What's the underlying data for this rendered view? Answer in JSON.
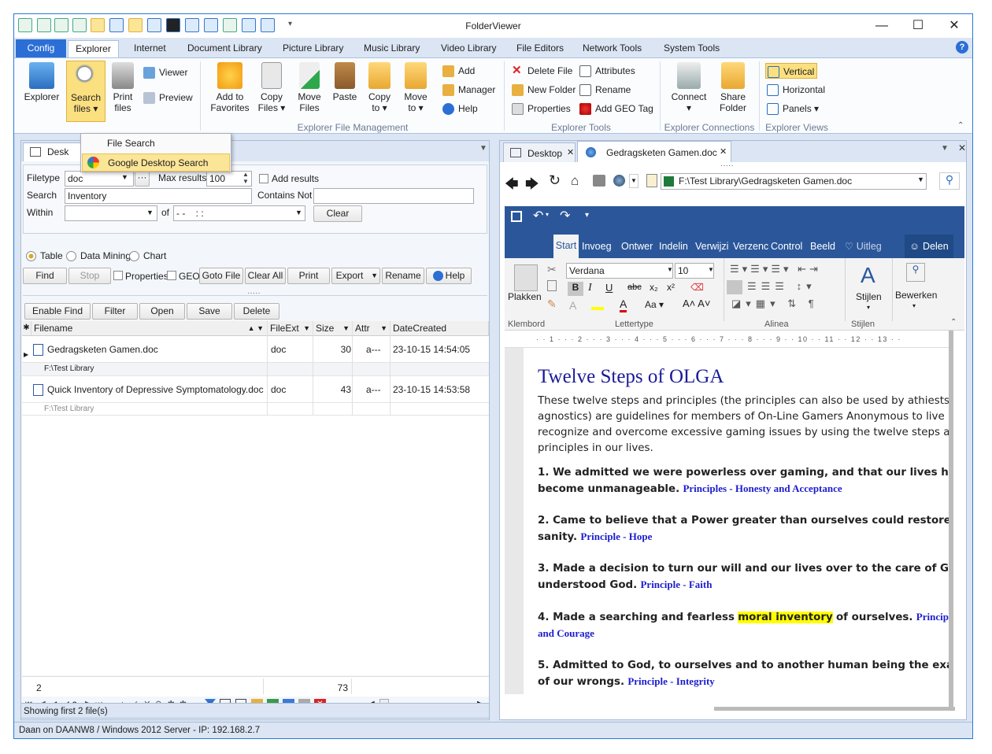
{
  "app": {
    "title": "FolderViewer"
  },
  "ribbon_tabs": {
    "config": "Config",
    "items": [
      "Explorer",
      "Internet",
      "Document Library",
      "Picture Library",
      "Music Library",
      "Video Library",
      "File Editors",
      "Network Tools",
      "System Tools"
    ]
  },
  "ribbon": {
    "explorer": "Explorer",
    "search_files": "Search\nfiles ▾",
    "print_files": "Print\nfiles",
    "viewer": "Viewer",
    "preview": "Preview",
    "add_fav": "Add to\nFavorites",
    "copy_files": "Copy\nFiles ▾",
    "move_files": "Move\nFiles",
    "paste": "Paste",
    "copy_to": "Copy\nto ▾",
    "move_to": "Move\nto ▾",
    "add": "Add",
    "manager": "Manager",
    "help": "Help",
    "group_fm": "Explorer File Management",
    "delete_file": "Delete File",
    "new_folder": "New Folder",
    "properties": "Properties",
    "attributes": "Attributes",
    "rename": "Rename",
    "add_geo": "Add GEO Tag",
    "group_tools": "Explorer Tools",
    "connect": "Connect\n▾",
    "share_folder": "Share\nFolder",
    "group_conn": "Explorer Connections",
    "vertical": "Vertical",
    "horizontal": "Horizontal",
    "panels": "Panels ▾",
    "group_views": "Explorer Views"
  },
  "dropdown": {
    "file_search": "File Search",
    "google": "Google Desktop Search"
  },
  "left": {
    "tab_desktop": "Desk",
    "filetype_label": "Filetype",
    "filetype": "doc",
    "max_results_label": "Max results",
    "max_results": "100",
    "add_results": "Add results",
    "search_label": "Search",
    "search": "Inventory",
    "contains_not_label": "Contains Not",
    "within_label": "Within",
    "of_label": "of",
    "date_value": "- -    : :",
    "clear": "Clear",
    "view_table": "Table",
    "view_mining": "Data Mining",
    "view_chart": "Chart",
    "find": "Find",
    "stop": "Stop",
    "properties": "Properties",
    "geo": "GEO",
    "goto_file": "Goto File",
    "clear_all": "Clear All",
    "print": "Print",
    "export": "Export",
    "rename": "Rename",
    "help": "Help",
    "enable_find": "Enable Find",
    "filter": "Filter",
    "open": "Open",
    "save": "Save",
    "delete": "Delete",
    "columns": [
      "Filename",
      "FileExt",
      "Size",
      "Attr",
      "DateCreated"
    ],
    "rows": [
      {
        "name": "Gedragsketen Gamen.doc",
        "ext": "doc",
        "size": "30",
        "attr": "a---",
        "date": "23-10-15 14:54:05",
        "path": "F:\\Test Library"
      },
      {
        "name": "Quick Inventory of Depressive Symptomatology.doc",
        "ext": "doc",
        "size": "43",
        "attr": "a---",
        "date": "23-10-15 14:53:58",
        "path": "F:\\Test Library"
      }
    ],
    "footer_count": "2",
    "footer_size": "73",
    "pager": "1 of 2",
    "status": "Showing first 2 file(s)"
  },
  "right": {
    "tab_desktop": "Desktop",
    "tab_doc": "Gedragsketen Gamen.doc",
    "address": "F:\\Test Library\\Gedragsketen Gamen.doc",
    "word_tabs": [
      "Start",
      "Invoeg",
      "Ontwer",
      "Indelin",
      "Verwijzi",
      "Verzenc",
      "Control",
      "Beeld"
    ],
    "uitleg": "Uitleg",
    "delen": "Delen",
    "font": "Verdana",
    "size": "10",
    "plakken": "Plakken",
    "stijlen": "Stijlen",
    "bewerken": "Bewerken",
    "grp_klembord": "Klembord",
    "grp_lettertype": "Lettertype",
    "grp_alinea": "Alinea",
    "grp_stijlen": "Stijlen",
    "doc_title": "Twelve Steps of OLGA",
    "intro": "These twelve steps and principles (the principles can also be used by athiests",
    "intro2": "agnostics) are guidelines for members of On-Line Gamers Anonymous to live",
    "intro3": "recognize and overcome excessive gaming issues by using the twelve steps a",
    "intro4": "principles in our lives.",
    "s1a": "1. We admitted we were powerless over gaming, and that our lives ha",
    "s1b": "become unmanageable.",
    "p1": "Principles - Honesty and Acceptance",
    "s2a": "2. Came to believe that a Power greater than ourselves could restore",
    "s2b": "sanity.",
    "p2": "Principle - Hope",
    "s3a": "3. Made a decision to turn our will and our lives over to the care of Go",
    "s3b": "understood God.",
    "p3": "Principle - Faith",
    "s4a": "4. Made a searching and fearless",
    "s4h": "moral inventory",
    "s4c": "of ourselves.",
    "p4a": "Principl",
    "p4b": "and Courage",
    "s5a": "5. Admitted to God, to ourselves and to another human being the exa",
    "s5b": "of our wrongs.",
    "p5": "Principle - Integrity"
  },
  "status": "Daan on DAANW8 / Windows 2012 Server  -  IP: 192.168.2.7"
}
